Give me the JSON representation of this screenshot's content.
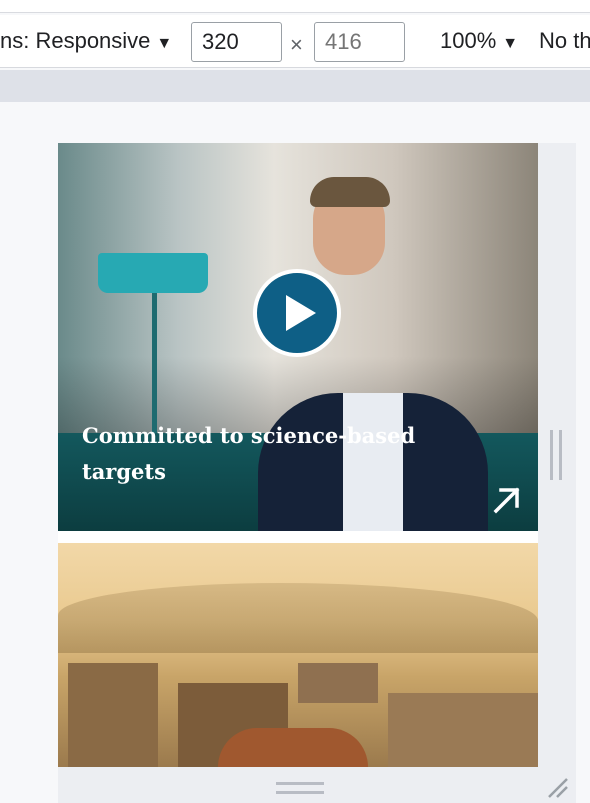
{
  "toolbar": {
    "dimensions_label": "ns: Responsive",
    "dimensions_caret": "▼",
    "width_value": "320",
    "height_placeholder": "416",
    "times_symbol": "×",
    "zoom_label": "100%",
    "zoom_caret": "▼",
    "throttle_label": "No th"
  },
  "card": {
    "title": "Committed to science-based targets",
    "play_icon": "play-icon",
    "arrow_icon": "arrow-up-right-icon",
    "accent_color": "#0e5f86"
  },
  "colors": {
    "toolbar_bg": "#ffffff",
    "media_bar_bg": "#dee1e8",
    "page_bg": "#f7f8fa"
  }
}
